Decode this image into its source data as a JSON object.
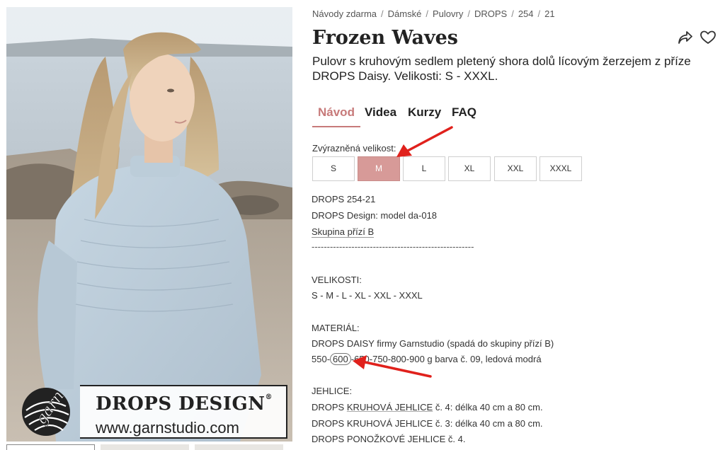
{
  "photo": {
    "brand_title": "DROPS DESIGN",
    "brand_reg": "®",
    "brand_url": "www.garnstudio.com",
    "logo_word": "garn",
    "logo_sub": "STUDIO"
  },
  "breadcrumb": [
    {
      "label": "Návody zdarma"
    },
    {
      "label": "Dámské"
    },
    {
      "label": "Pulovry"
    },
    {
      "label": "DROPS"
    },
    {
      "label": "254"
    },
    {
      "label": "21"
    }
  ],
  "breadcrumb_sep": "/",
  "title": "Frozen Waves",
  "subtitle": "Pulovr s kruhovým sedlem pletený shora dolů lícovým žerzejem z příze DROPS Daisy. Velikosti: S - XXXL.",
  "actions": {
    "share_icon": "share-icon",
    "favorite_icon": "heart-icon"
  },
  "tabs": [
    {
      "label": "Návod",
      "active": true
    },
    {
      "label": "Videa",
      "active": false
    },
    {
      "label": "Kurzy",
      "active": false
    },
    {
      "label": "FAQ",
      "active": false
    }
  ],
  "accent_color": "#c77a7a",
  "selected_color": "#d79a98",
  "size_label": "Zvýrazněná velikost:",
  "sizes": [
    {
      "label": "S",
      "selected": false
    },
    {
      "label": "M",
      "selected": true
    },
    {
      "label": "L",
      "selected": false
    },
    {
      "label": "XL",
      "selected": false
    },
    {
      "label": "XXL",
      "selected": false
    },
    {
      "label": "XXXL",
      "selected": false
    }
  ],
  "pattern": {
    "code": "DROPS 254-21",
    "design": "DROPS Design: model da-018",
    "yarn_group_link": "Skupina přízí B",
    "divider": "-----------------------------------------------------",
    "sizes_heading": "VELIKOSTI:",
    "sizes_list": "S - M - L - XL - XXL - XXXL",
    "material_heading": "MATERIÁL:",
    "material_line": "DROPS DAISY firmy Garnstudio (spadá do skupiny přízí B)",
    "amount_prefix": "550-",
    "amount_highlight": "600",
    "amount_suffix": "-650-750-800-900 g barva č. 09, ledová modrá",
    "needles_heading": "JEHLICE:",
    "needle1_a": "DROPS ",
    "needle1_link": "KRUHOVÁ JEHLICE",
    "needle1_b": " č. 4: délka 40 cm a 80 cm.",
    "needle2": "DROPS KRUHOVÁ JEHLICE č. 3: délka 40 cm a 80 cm.",
    "needle3": "DROPS PONOŽKOVÉ JEHLICE č. 4."
  },
  "annotation_color": "#e0211c"
}
